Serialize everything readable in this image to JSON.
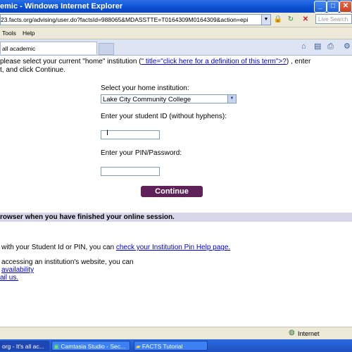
{
  "window": {
    "title": "emic - Windows Internet Explorer",
    "min_icon": "minimize-icon",
    "max_icon": "maximize-icon",
    "close_icon": "close-icon"
  },
  "address_bar": {
    "url": "23.facts.org/advising/user.do?factsId=988065&MDASSTTE=T0164309M0164309&action=epi",
    "search_placeholder": "Live Search"
  },
  "menu": {
    "items": [
      "Tools",
      "Help"
    ]
  },
  "tab": {
    "label": "all academic"
  },
  "content": {
    "intro_line1_prefix": "please select your current \"home\" institution (",
    "intro_link": "\" title=\"click here for a definition of this term\">?",
    "intro_line1_suffix": ") , enter",
    "intro_line2": "t, and click Continue.",
    "home_institution_label": "Select your home institution:",
    "home_institution_value": "Lake City Community College",
    "student_id_label": "Enter your student ID (without hyphens):",
    "student_id_value": "",
    "pin_label": "Enter your PIN/Password:",
    "pin_value": "",
    "continue_label": "Continue",
    "banner_text": "rowser when you have finished your online session.",
    "help_line1_prefix": "with your Student Id or PIN, you can ",
    "help_line1_link": "check your Institution Pin Help page.",
    "help_line2": "accessing an institution's website, you can",
    "help_line3_link": "availability",
    "help_line4_link": "ail us."
  },
  "status_bar": {
    "zone": "Internet"
  },
  "taskbar": {
    "items": [
      {
        "label": "org - It's all ac...",
        "icon": "ie-icon"
      },
      {
        "label": "Camtasia Studio - Sec...",
        "icon": "camtasia-icon"
      },
      {
        "label": "FACTS Tutorial",
        "icon": "folder-icon"
      }
    ]
  }
}
